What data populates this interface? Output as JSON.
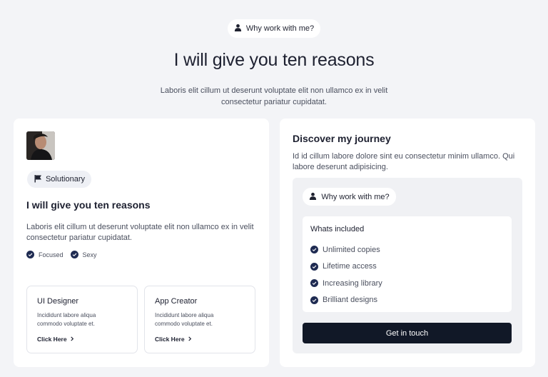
{
  "hero": {
    "pill_label": "Why work with me?",
    "title": "I will give you ten reasons",
    "subtitle": "Laboris elit cillum ut deserunt voluptate elit non ullamco ex in velit consectetur pariatur cupidatat."
  },
  "left_card": {
    "chip_label": "Solutionary",
    "title": "I will give you ten reasons",
    "description": "Laboris elit cillum ut deserunt voluptate elit non ullamco ex in velit consectetur pariatur cupidatat.",
    "features": [
      "Focused",
      "Sexy"
    ],
    "mini_cards": [
      {
        "title": "UI Designer",
        "description": "Incididunt labore aliqua commodo voluptate et.",
        "link": "Click Here"
      },
      {
        "title": "App Creator",
        "description": "Incididunt labore aliqua commodo voluptate et.",
        "link": "Click Here"
      }
    ]
  },
  "right_card": {
    "title": "Discover my journey",
    "description": "Id id cillum labore dolore sint eu consectetur minim ullamco. Qui labore deserunt adipisicing.",
    "pill_label": "Why work with me?",
    "included_title": "Whats included",
    "included_items": [
      "Unlimited copies",
      "Lifetime access",
      "Increasing library",
      "Brilliant designs"
    ],
    "cta_label": "Get in touch"
  },
  "colors": {
    "background": "#f3f4f7",
    "check_accent": "#1f2b52",
    "cta_background": "#111827"
  },
  "icons": {
    "pill_icon": "user-icon",
    "chip_icon": "flag-icon",
    "check_icon": "check-circle-icon",
    "link_icon": "chevron-right-icon"
  }
}
